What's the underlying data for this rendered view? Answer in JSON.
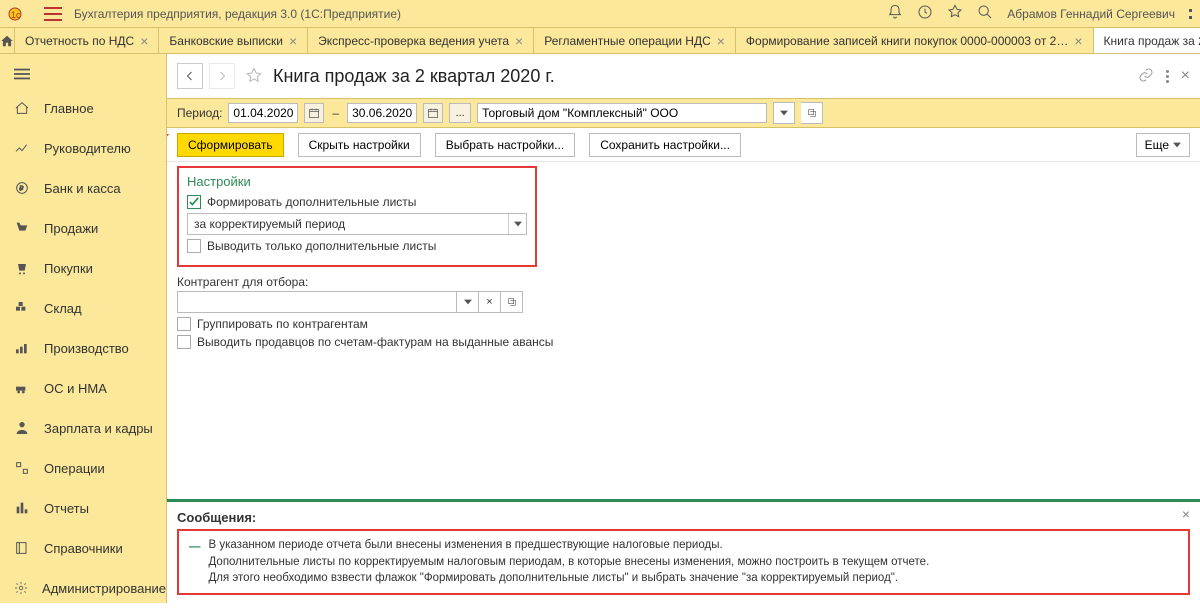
{
  "app": {
    "title": "Бухгалтерия предприятия, редакция 3.0  (1С:Предприятие)",
    "user": "Абрамов Геннадий Сергеевич"
  },
  "tabs": [
    "Отчетность по НДС",
    "Банковские выписки",
    "Экспресс-проверка ведения учета",
    "Регламентные операции НДС",
    "Формирование записей книги покупок 0000-000003 от 2…",
    "Книга продаж за 2 квартал 2020 г."
  ],
  "sidebar": {
    "items": [
      "Главное",
      "Руководителю",
      "Банк и касса",
      "Продажи",
      "Покупки",
      "Склад",
      "Производство",
      "ОС и НМА",
      "Зарплата и кадры",
      "Операции",
      "Отчеты",
      "Справочники",
      "Администрирование"
    ]
  },
  "page": {
    "title": "Книга продаж за 2 квартал 2020 г."
  },
  "period": {
    "label": "Период:",
    "from": "01.04.2020",
    "to": "30.06.2020",
    "org": "Торговый дом \"Комплексный\" ООО"
  },
  "toolbar": {
    "generate": "Сформировать",
    "hide_settings": "Скрыть настройки",
    "choose_settings": "Выбрать настройки...",
    "save_settings": "Сохранить настройки...",
    "more": "Еще"
  },
  "settings": {
    "title": "Настройки",
    "extra_sheets": "Формировать дополнительные листы",
    "period_combo": "за корректируемый период",
    "only_extra": "Выводить только дополнительные листы",
    "kontr_label": "Контрагент для отбора:",
    "group_kontr": "Группировать по контрагентам",
    "sellers_adv": "Выводить продавцов по счетам-фактурам на выданные авансы"
  },
  "messages": {
    "title": "Сообщения:",
    "line1": "В указанном периоде отчета были внесены изменения в предшествующие налоговые периоды.",
    "line2": "Дополнительные листы по корректируемым налоговым периодам, в которые внесены изменения, можно построить в текущем отчете.",
    "line3": "Для этого необходимо взвести флажок \"Формировать дополнительные листы\" и выбрать значение \"за корректируемый период\"."
  }
}
